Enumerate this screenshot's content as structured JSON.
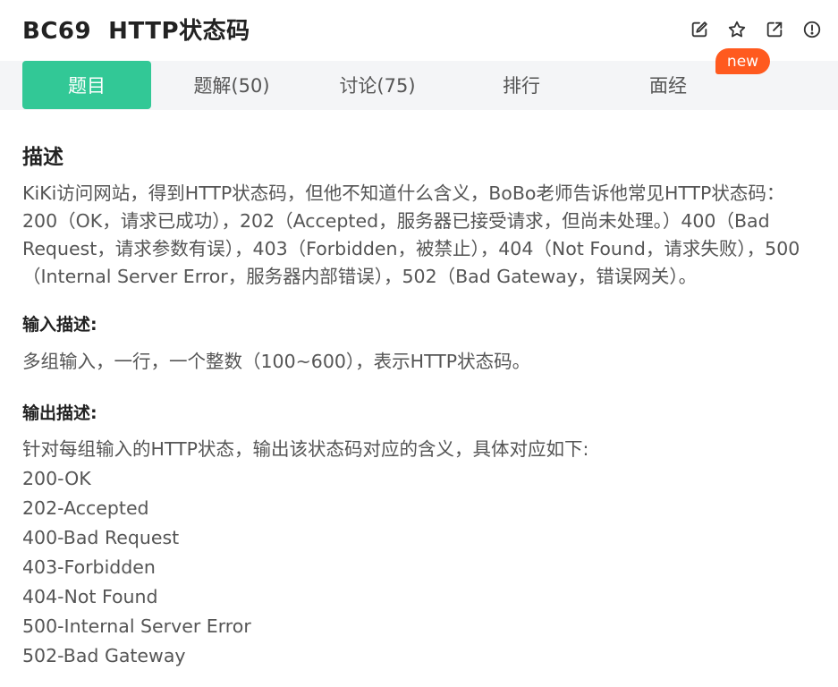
{
  "header": {
    "title": "BC69  HTTP状态码"
  },
  "toolbar": {
    "icons": [
      "edit-icon",
      "star-icon",
      "share-icon",
      "info-icon"
    ]
  },
  "tabs": [
    {
      "label": "题目",
      "active": true
    },
    {
      "label": "题解(50)",
      "active": false
    },
    {
      "label": "讨论(75)",
      "active": false
    },
    {
      "label": "排行",
      "active": false
    },
    {
      "label": "面经",
      "active": false
    }
  ],
  "badge": "new",
  "colors": {
    "accent": "#32c896",
    "badge": "#ff5a1f"
  },
  "description": {
    "heading": "描述",
    "text": "KiKi访问网站，得到HTTP状态码，但他不知道什么含义，BoBo老师告诉他常见HTTP状态码：200（OK，请求已成功），202（Accepted，服务器已接受请求，但尚未处理。）400（Bad Request，请求参数有误），403（Forbidden，被禁止），404（Not Found，请求失败），500（Internal Server Error，服务器内部错误），502（Bad Gateway，错误网关）。"
  },
  "input": {
    "heading": "输入描述:",
    "text": "多组输入，一行，一个整数（100~600），表示HTTP状态码。"
  },
  "output": {
    "heading": "输出描述:",
    "intro": "针对每组输入的HTTP状态，输出该状态码对应的含义，具体对应如下:",
    "items": [
      "200-OK",
      "202-Accepted",
      "400-Bad Request",
      "403-Forbidden",
      "404-Not Found",
      "500-Internal Server Error",
      "502-Bad Gateway"
    ]
  }
}
